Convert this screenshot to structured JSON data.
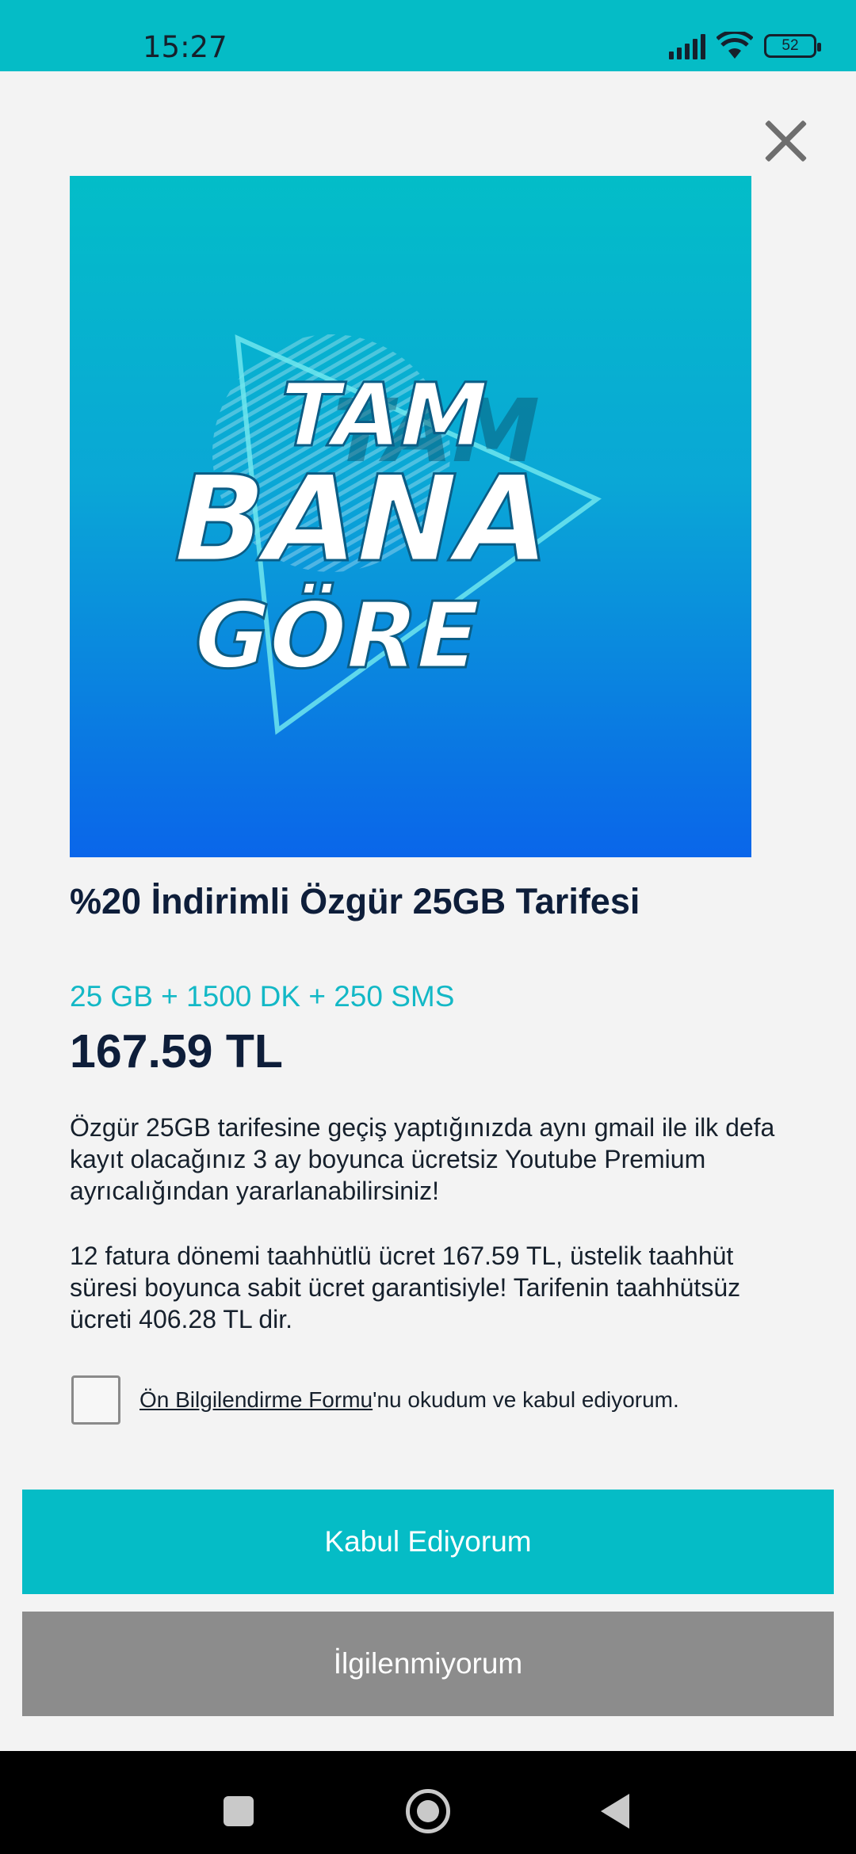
{
  "status_bar": {
    "time": "15:27",
    "battery_level": "52",
    "icons": [
      "signal-icon",
      "wifi-icon",
      "battery-icon"
    ]
  },
  "dialog": {
    "close_icon": "close-icon",
    "image_text": {
      "line1": "TAM",
      "line2": "BANA",
      "line3": "GÖRE"
    },
    "title": "%20 İndirimli Özgür 25GB Tarifesi",
    "package_summary": "25 GB + 1500 DK + 250 SMS",
    "price": "167.59 TL",
    "description_1": "Özgür 25GB tarifesine geçiş yaptığınızda aynı gmail ile ilk defa kayıt olacağınız 3 ay boyunca ücretsiz Youtube Premium ayrıcalığından yararlanabilirsiniz!",
    "description_2": "12 fatura dönemi taahhütlü ücret 167.59 TL, üstelik taahhüt süresi boyunca sabit ücret garantisiyle! Tarifenin taahhütsüz ücreti 406.28 TL dir.",
    "consent": {
      "checked": false,
      "link_text": "Ön Bilgilendirme Formu",
      "rest_text": "'nu okudum ve kabul ediyorum."
    },
    "accept_label": "Kabul Ediyorum",
    "decline_label": "İlgilenmiyorum"
  },
  "colors": {
    "accent": "#05bcc6",
    "title_text": "#0e1e3a",
    "decline_button": "#8c8c8c",
    "image_gradient_top": "#03bdc8",
    "image_gradient_bottom": "#0a66ea"
  },
  "nav_bar": {
    "icons": [
      "recent-apps-icon",
      "home-icon",
      "back-icon"
    ]
  }
}
